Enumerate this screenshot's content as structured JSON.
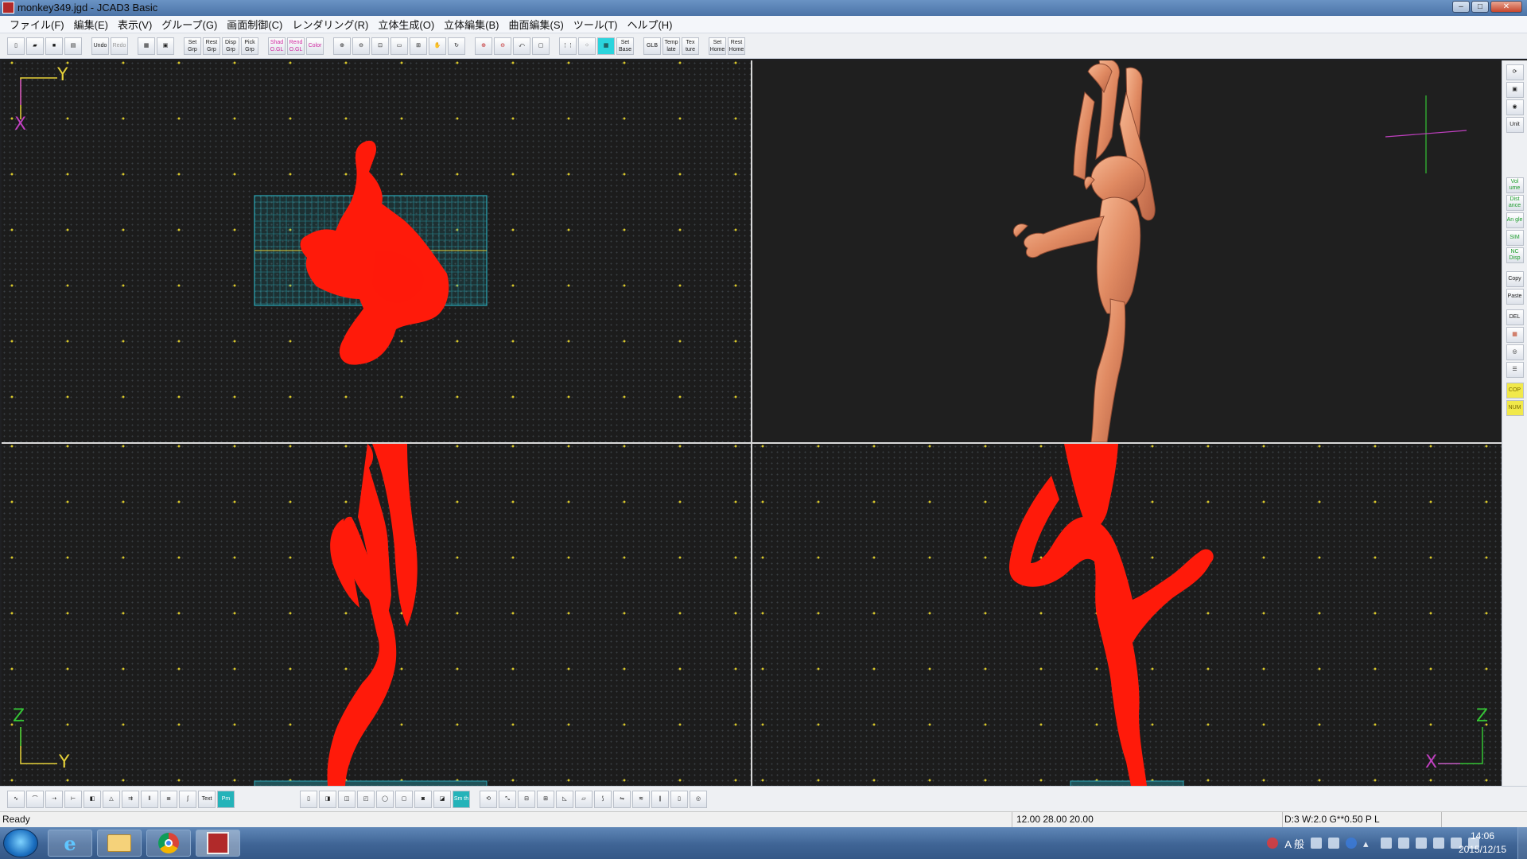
{
  "window": {
    "title": "monkey349.jgd - JCAD3 Basic",
    "controls": {
      "minimize": "–",
      "maximize": "□",
      "close": "✕"
    }
  },
  "menu": [
    "ファイル(F)",
    "編集(E)",
    "表示(V)",
    "グループ(G)",
    "画面制御(C)",
    "レンダリング(R)",
    "立体生成(O)",
    "立体編集(B)",
    "曲面編集(S)",
    "ツール(T)",
    "ヘルプ(H)"
  ],
  "toolbar_top": {
    "groups": [
      [
        "",
        "",
        "",
        ""
      ],
      [
        "Undo",
        "Redo"
      ],
      [
        "",
        ""
      ],
      [
        "Set Grp",
        "Rest Grp",
        "Disp Grp",
        "Pick Grp"
      ],
      [
        "Shad O.GL",
        "Rend O.GL",
        "Color"
      ],
      [
        "",
        "",
        "",
        "",
        "",
        "",
        ""
      ],
      [
        "",
        "",
        "",
        ""
      ],
      [
        "",
        "",
        "",
        "Set Base"
      ],
      [
        "GLB",
        "Temp late",
        "Tex ture"
      ],
      [
        "Set Home",
        "Rest Home"
      ]
    ]
  },
  "toolbar_bottom": {
    "groups": [
      [
        "",
        "",
        "",
        "",
        "",
        "",
        "",
        "",
        "",
        "",
        "Text",
        "Pm"
      ],
      [
        "",
        "",
        "",
        "",
        "",
        "",
        "",
        "",
        "Sm th"
      ],
      [
        "",
        "",
        "",
        "",
        "",
        "",
        "",
        "",
        "",
        "",
        "",
        ""
      ]
    ]
  },
  "palette": {
    "group1": [
      "",
      "",
      "",
      "Unit"
    ],
    "group2": [
      "Vol ume",
      "Dist ance",
      "An gle",
      "SIM",
      "NC Disp"
    ],
    "group3": [
      "Copy",
      "Paste",
      "DEL",
      "",
      "",
      "",
      ""
    ],
    "group4": [
      "COP",
      "NUM"
    ]
  },
  "viewports": {
    "top": {
      "axis_h": "Y",
      "axis_v": "X"
    },
    "front": {
      "axis_v": "Z",
      "axis_h": "Y"
    },
    "side": {
      "axis_v": "Z",
      "axis_h": "X"
    }
  },
  "colors": {
    "model_wire": "#ff1a0a",
    "model_render": "#e9946e",
    "grid_dot": "#d8c72a",
    "axis_yellow": "#e6d23a",
    "axis_magenta": "#c040c0",
    "axis_green": "#35c435",
    "stone_grid": "#2aa7b6"
  },
  "status": {
    "ready": "Ready",
    "coords": "12.00 28.00 20.00",
    "info": "D:3 W:2.0  G**0.50 P   L"
  },
  "taskbar": {
    "apps": [
      "internet-explorer-icon",
      "explorer-icon",
      "chrome-icon",
      "jcad-icon"
    ],
    "tray_text": "A 般",
    "clock_time": "14:06",
    "clock_date": "2015/12/15"
  }
}
